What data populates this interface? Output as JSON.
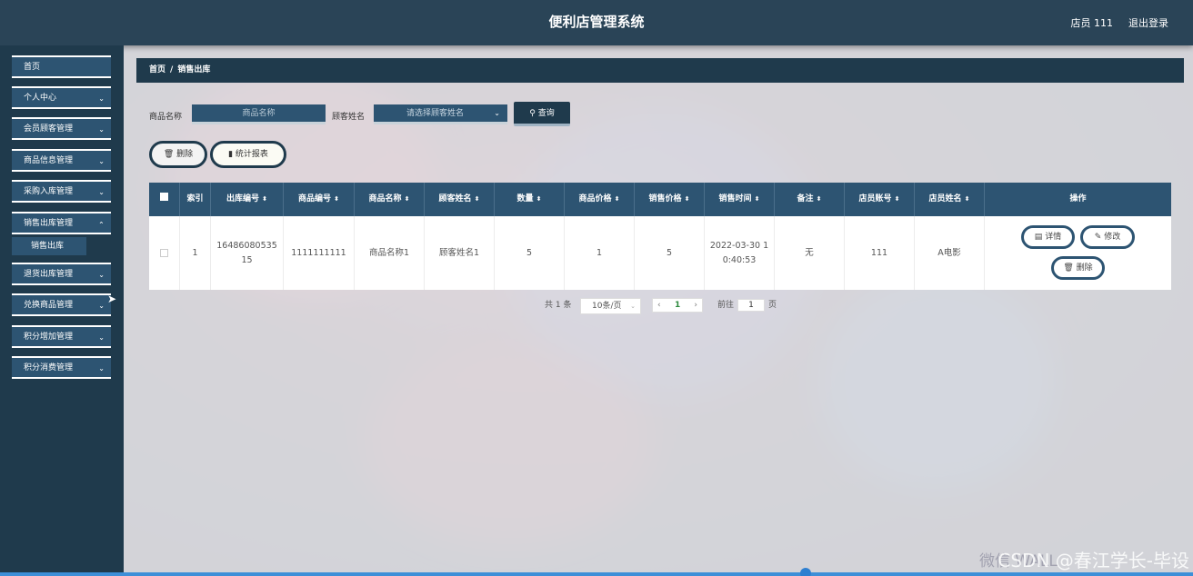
{
  "header": {
    "title": "便利店管理系统",
    "user": "店员 111",
    "logout": "退出登录"
  },
  "sidebar": {
    "items": [
      {
        "label": "首页"
      },
      {
        "label": "个人中心"
      },
      {
        "label": "会员顾客管理"
      },
      {
        "label": "商品信息管理"
      },
      {
        "label": "采购入库管理"
      },
      {
        "label": "销售出库管理"
      },
      {
        "label": "退货出库管理"
      },
      {
        "label": "兑换商品管理"
      },
      {
        "label": "积分增加管理"
      },
      {
        "label": "积分消费管理"
      }
    ],
    "sub_item": "销售出库",
    "chevron": "⌄"
  },
  "breadcrumb": {
    "home": "首页",
    "sep": "/",
    "current": "销售出库"
  },
  "search": {
    "product_label": "商品名称",
    "product_placeholder": "商品名称",
    "customer_label": "顾客姓名",
    "customer_placeholder": "请选择顾客姓名",
    "query_button": "查询"
  },
  "actions": {
    "delete": "删除",
    "report": "统计报表"
  },
  "table": {
    "headers": [
      "索引",
      "出库编号",
      "商品编号",
      "商品名称",
      "顾客姓名",
      "数量",
      "商品价格",
      "销售价格",
      "销售时间",
      "备注",
      "店员账号",
      "店员姓名",
      "操作"
    ],
    "rows": [
      {
        "index": "1",
        "out_no": "1648608053515",
        "product_no": "1111111111",
        "product_name": "商品名称1",
        "customer": "顾客姓名1",
        "quantity": "5",
        "product_price": "1",
        "sale_price": "5",
        "sale_time": "2022-03-30 10:40:53",
        "remark": "无",
        "clerk_account": "111",
        "clerk_name": "A电影"
      }
    ],
    "ops": {
      "detail": "详情",
      "edit": "修改",
      "delete": "删除"
    }
  },
  "pagination": {
    "total": "共 1 条",
    "page_size": "10条/页",
    "current_page": "1",
    "goto_label": "前往",
    "goto_value": "1",
    "page_suffix": "页"
  },
  "watermark": "CSDN @春江学长-毕设",
  "watermark_faint": "微信 WALL"
}
